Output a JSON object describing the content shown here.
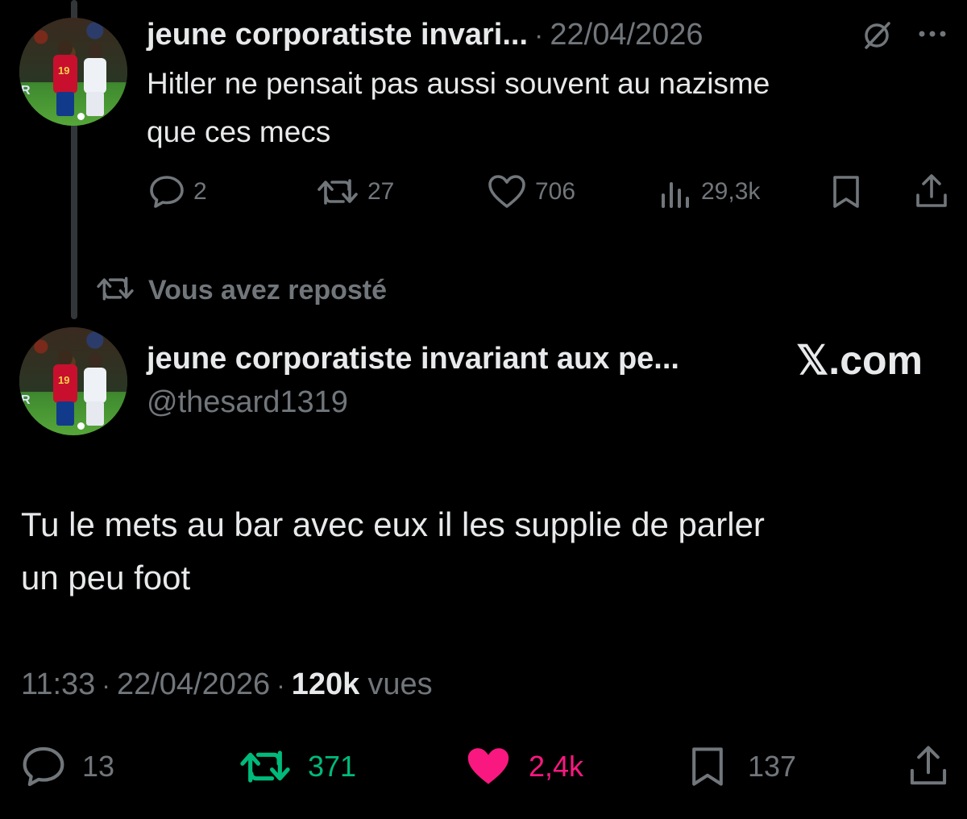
{
  "post1": {
    "author_name": "jeune corporatiste invari...",
    "dot": "·",
    "date": "22/04/2026",
    "text_line1": "Hitler ne pensait pas aussi souvent au nazisme",
    "text_line2": "que ces mecs",
    "actions": {
      "replies": "2",
      "reposts": "27",
      "likes": "706",
      "views": "29,3k"
    }
  },
  "repost_banner": {
    "label": "Vous avez reposté"
  },
  "post2": {
    "author_name": "jeune corporatiste invariant aux pe...",
    "handle": "@thesard1319",
    "text_line1": "Tu le mets au bar avec eux il les supplie de parler",
    "text_line2": "un peu foot",
    "time": "11:33",
    "dot1": "·",
    "date": "22/04/2026",
    "dot2": "·",
    "views_count": "120k",
    "views_label": "vues",
    "actions": {
      "replies": "13",
      "reposts": "371",
      "likes": "2,4k",
      "bookmarks": "137"
    }
  },
  "watermark": {
    "x_logo": "𝕏",
    "domain": ".com"
  },
  "colors": {
    "background": "#000000",
    "text": "#e7e9ea",
    "muted": "#71767b",
    "repost_active": "#00ba7c",
    "like_active": "#f91880"
  },
  "icons": [
    "reply-icon",
    "repost-icon",
    "like-icon",
    "views-icon",
    "bookmark-icon",
    "share-icon",
    "grok-icon",
    "more-icon"
  ]
}
